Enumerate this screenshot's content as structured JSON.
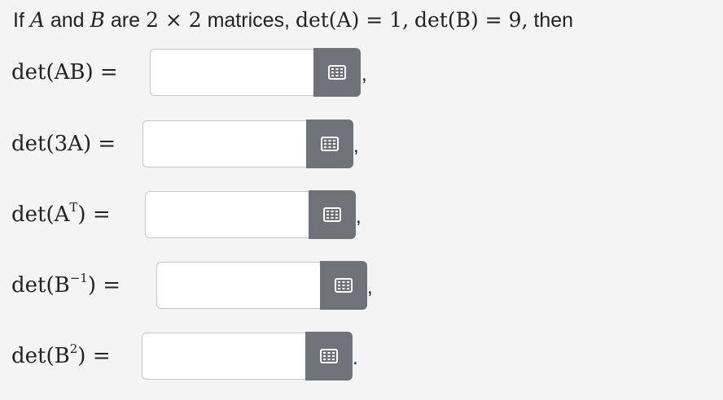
{
  "intro": {
    "prefix": "If",
    "a": "A",
    "and": "and",
    "b": "B",
    "are": "are",
    "dims": "2 × 2",
    "matrices": "matrices,",
    "detA": "det(A) = 1,",
    "detB": "det(B) = 9,",
    "then": "then"
  },
  "rows": [
    {
      "label_main": "det(AB) =",
      "sup": "",
      "punct": ",",
      "value": "",
      "placeholder": ""
    },
    {
      "label_main": "det(3A) =",
      "sup": "",
      "punct": ",",
      "value": "",
      "placeholder": ""
    },
    {
      "label_main": "det(A",
      "sup": "T",
      "label_tail": ") =",
      "punct": ",",
      "value": "",
      "placeholder": ""
    },
    {
      "label_main": "det(B",
      "sup": "−1",
      "label_tail": ") =",
      "punct": ",",
      "value": "",
      "placeholder": ""
    },
    {
      "label_main": "det(B",
      "sup": "2",
      "label_tail": ") =",
      "punct": ".",
      "value": "",
      "placeholder": ""
    }
  ],
  "icons": {
    "keyboard_button": "keypad-grid-icon"
  },
  "colors": {
    "button": "#6e737a",
    "background": "#f4f4f4",
    "input_border": "#c7c7c7"
  }
}
